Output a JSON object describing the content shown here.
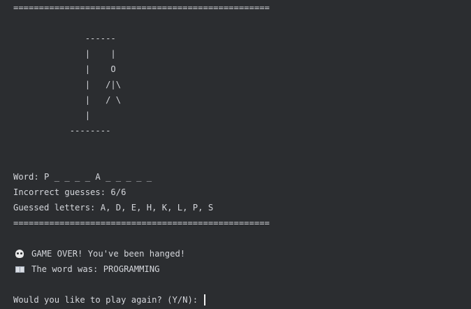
{
  "terminal": {
    "separator_top": "==================================================",
    "gallows": "              ------\n              |    |\n              |    O\n              |   /|\\\n              |   / \\\n              |\n           --------",
    "word_line": "Word: P _ _ _ _ A _ _ _ _ _",
    "incorrect_line": "Incorrect guesses: 6/6",
    "guessed_line": "Guessed letters: A, D, E, H, K, L, P, S",
    "separator_bottom": "==================================================",
    "game_over_icon": "skull-emoji",
    "game_over_text": "GAME OVER! You've been hanged!",
    "reveal_icon": "open-book-emoji",
    "reveal_text": "The word was: PROGRAMMING",
    "prompt_text": "Would you like to play again? (Y/N): "
  },
  "colors": {
    "background": "#2b2d30",
    "text": "#d4d6db"
  }
}
